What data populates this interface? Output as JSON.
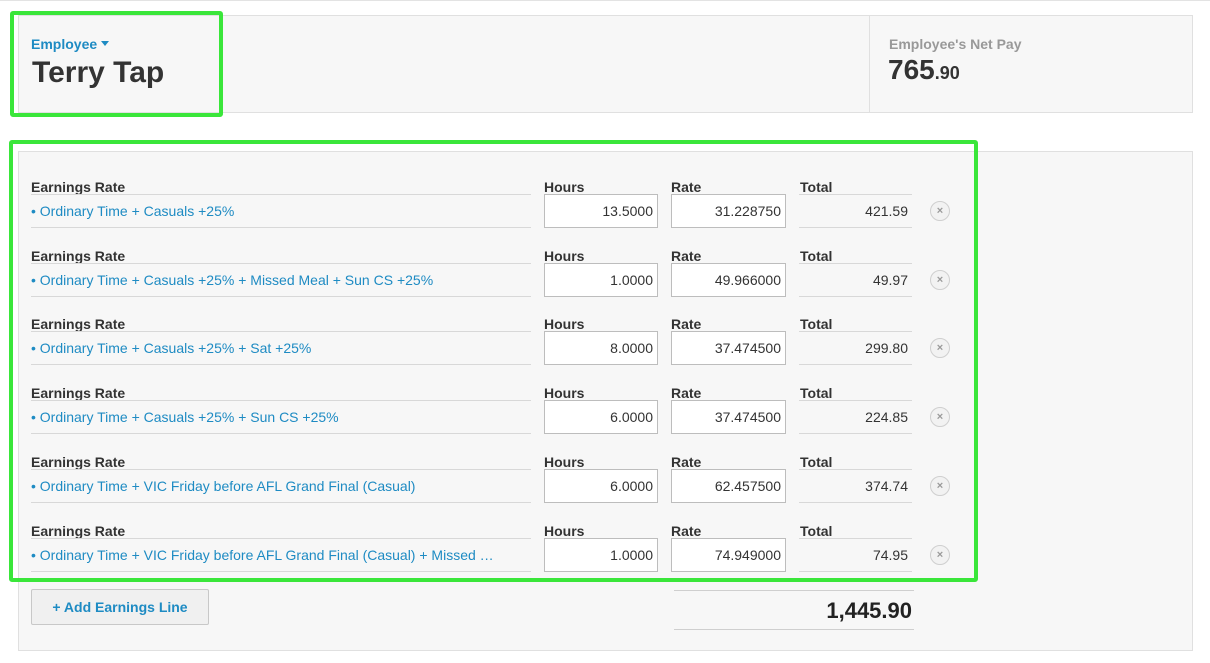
{
  "header": {
    "employee_label": "Employee",
    "employee_name": "Terry Tap",
    "net_pay_label": "Employee's Net Pay",
    "net_pay_whole": "765",
    "net_pay_cents": ".90"
  },
  "columns": {
    "earnings_rate": "Earnings Rate",
    "hours": "Hours",
    "rate": "Rate",
    "total": "Total"
  },
  "lines": [
    {
      "earnings_rate": "• Ordinary Time + Casuals +25%",
      "hours": "13.5000",
      "rate": "31.228750",
      "total": "421.59"
    },
    {
      "earnings_rate": "• Ordinary Time + Casuals +25% + Missed Meal + Sun CS +25%",
      "hours": "1.0000",
      "rate": "49.966000",
      "total": "49.97"
    },
    {
      "earnings_rate": "• Ordinary Time + Casuals +25% + Sat +25%",
      "hours": "8.0000",
      "rate": "37.474500",
      "total": "299.80"
    },
    {
      "earnings_rate": "• Ordinary Time + Casuals +25% + Sun CS +25%",
      "hours": "6.0000",
      "rate": "37.474500",
      "total": "224.85"
    },
    {
      "earnings_rate": "• Ordinary Time + VIC Friday before AFL Grand Final (Casual)",
      "hours": "6.0000",
      "rate": "62.457500",
      "total": "374.74"
    },
    {
      "earnings_rate": "• Ordinary Time + VIC Friday before AFL Grand Final (Casual) + Missed …",
      "hours": "1.0000",
      "rate": "74.949000",
      "total": "74.95"
    }
  ],
  "actions": {
    "add_line_label": "+ Add Earnings Line",
    "remove_symbol": "×"
  },
  "grand_total": "1,445.90",
  "colors": {
    "link_blue": "#1e8bc3",
    "highlight_green": "#3ae63a"
  }
}
